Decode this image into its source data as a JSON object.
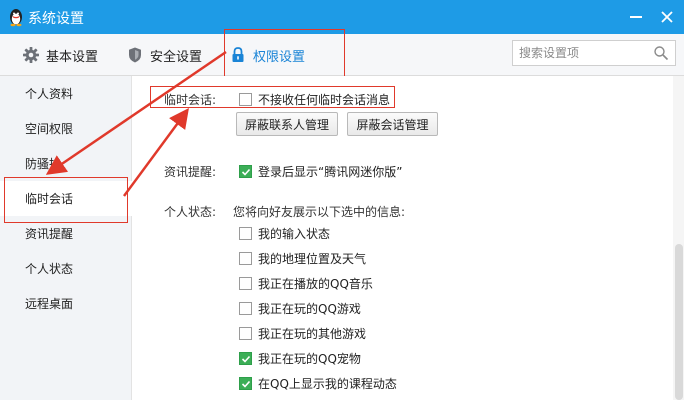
{
  "window": {
    "title": "系统设置",
    "icons": {
      "app": "qq-penguin-icon",
      "minimize": "minimize-icon",
      "close": "close-icon"
    }
  },
  "tabs": [
    {
      "label": "基本设置",
      "icon": "gear-icon"
    },
    {
      "label": "安全设置",
      "icon": "shield-icon"
    },
    {
      "label": "权限设置",
      "icon": "lock-icon",
      "selected": true
    }
  ],
  "search": {
    "placeholder": "搜索设置项",
    "icon": "search-icon"
  },
  "sidebar": {
    "items": [
      {
        "label": "个人资料"
      },
      {
        "label": "空间权限"
      },
      {
        "label": "防骚扰"
      },
      {
        "label": "临时会话",
        "selected": true
      },
      {
        "label": "资讯提醒"
      },
      {
        "label": "个人状态"
      },
      {
        "label": "远程桌面"
      }
    ]
  },
  "temp_session": {
    "label": "临时会话:",
    "option": {
      "label": "不接收任何临时会话消息",
      "checked": false
    },
    "buttons": [
      "屏蔽联系人管理",
      "屏蔽会话管理"
    ]
  },
  "news_reminder": {
    "label": "资讯提醒:",
    "option": {
      "label": "登录后显示“腾讯网迷你版”",
      "checked": true
    }
  },
  "personal_status": {
    "label": "个人状态:",
    "description": "您将向好友展示以下选中的信息:",
    "options": [
      {
        "label": "我的输入状态",
        "checked": false
      },
      {
        "label": "我的地理位置及天气",
        "checked": false
      },
      {
        "label": "我正在播放的QQ音乐",
        "checked": false
      },
      {
        "label": "我正在玩的QQ游戏",
        "checked": false
      },
      {
        "label": "我正在玩的其他游戏",
        "checked": false
      },
      {
        "label": "我正在玩的QQ宠物",
        "checked": true
      },
      {
        "label": "在QQ上显示我的课程动态",
        "checked": true
      }
    ]
  },
  "colors": {
    "titlebar": "#1e9be6",
    "highlight": "#e0392b",
    "checkbox_checked": "#3cae57",
    "selected_tab_text": "#1a84d6"
  }
}
